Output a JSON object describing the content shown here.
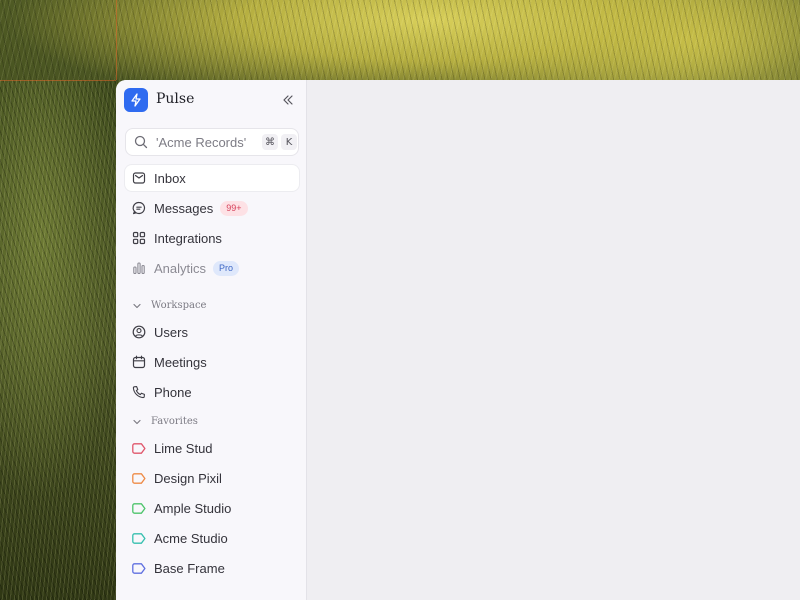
{
  "app": {
    "title": "Pulse",
    "accent": "#2f6bf0"
  },
  "search": {
    "placeholder": "'Acme Records'",
    "shortcut": [
      "⌘",
      "K"
    ]
  },
  "nav": {
    "items": [
      {
        "label": "Inbox",
        "icon": "inbox-icon",
        "active": true
      },
      {
        "label": "Messages",
        "icon": "message-icon",
        "badge": "99+",
        "badge_color": "#d6405a"
      },
      {
        "label": "Integrations",
        "icon": "grid-icon"
      },
      {
        "label": "Analytics",
        "icon": "bar-chart-icon",
        "badge": "Pro",
        "badge_color": "#3e67c5",
        "disabled": true
      }
    ]
  },
  "workspace": {
    "label": "Workspace",
    "items": [
      {
        "label": "Users",
        "icon": "user-circle-icon"
      },
      {
        "label": "Meetings",
        "icon": "calendar-icon"
      },
      {
        "label": "Phone",
        "icon": "phone-icon"
      }
    ]
  },
  "favorites": {
    "label": "Favorites",
    "items": [
      {
        "label": "Lime Stud",
        "color": "#e0566b"
      },
      {
        "label": "Design Pixil",
        "color": "#ee8a45"
      },
      {
        "label": "Ample Studio",
        "color": "#4cc46a"
      },
      {
        "label": "Acme Studio",
        "color": "#35bfae"
      },
      {
        "label": "Base Frame",
        "color": "#5f6fe0"
      }
    ]
  }
}
